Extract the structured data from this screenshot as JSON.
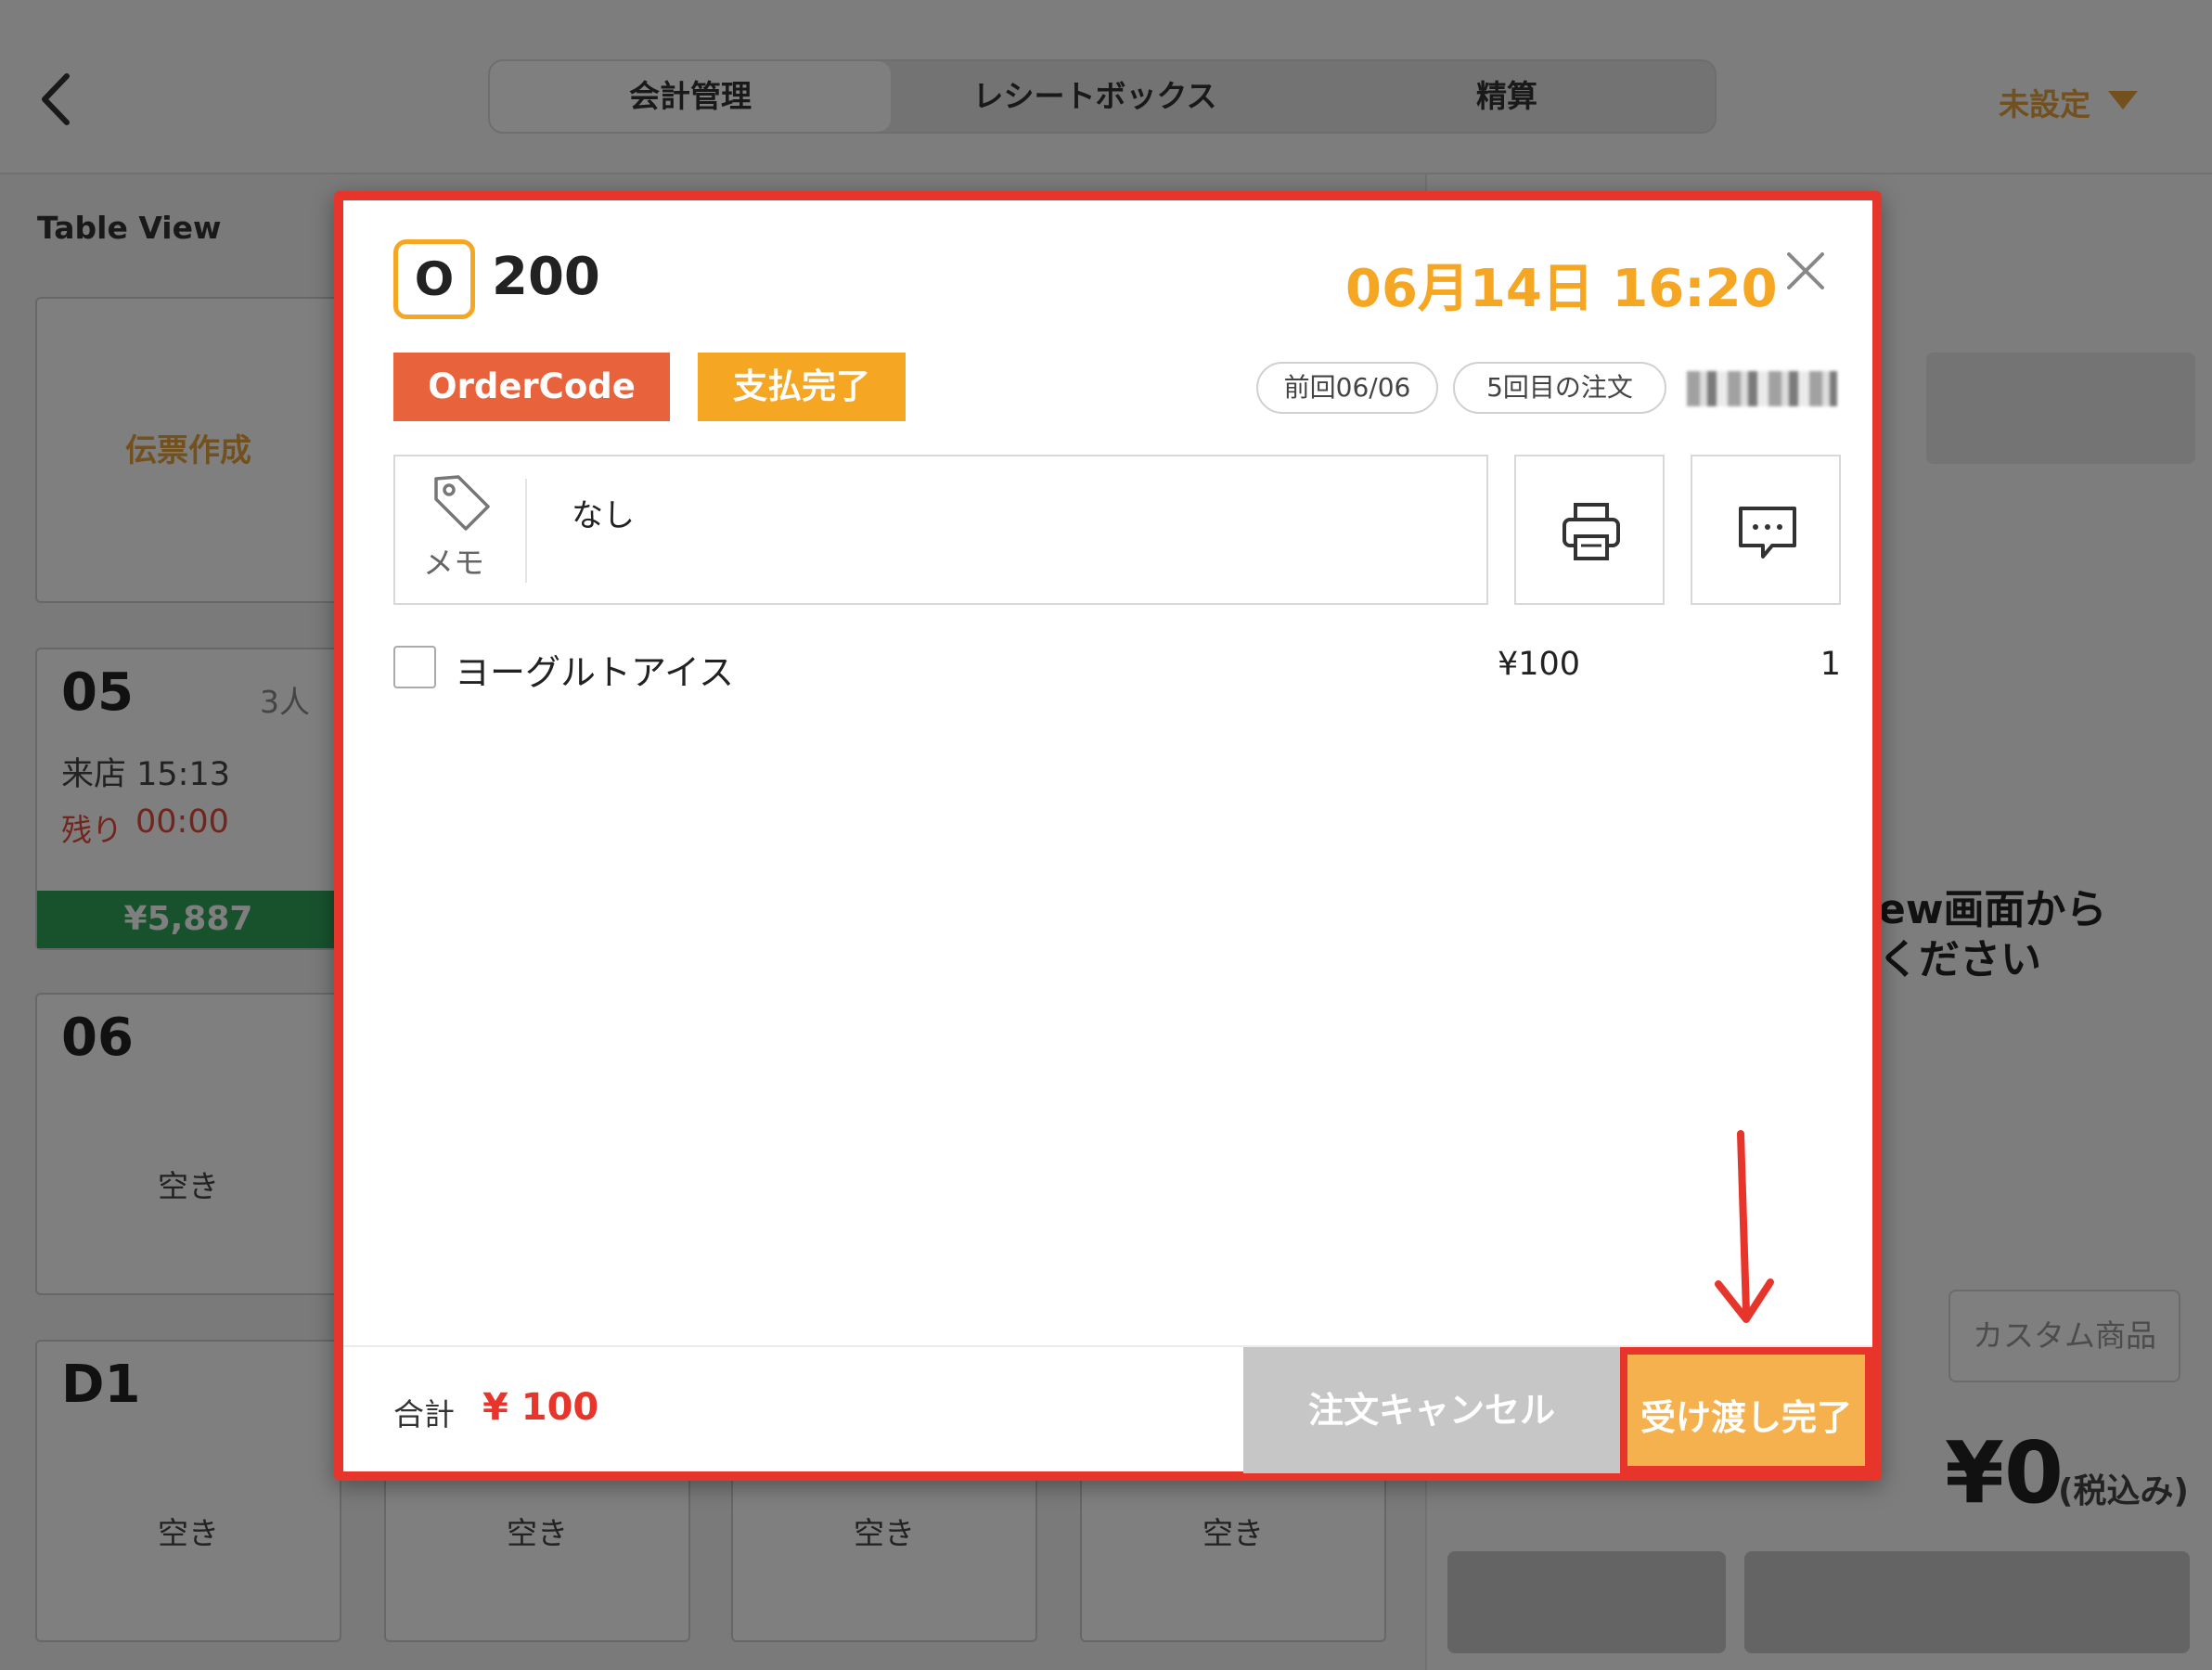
{
  "header": {
    "tabs": [
      "会計管理",
      "レシートボックス",
      "精算"
    ],
    "active_tab": "会計管理",
    "status_label": "未設定"
  },
  "table_view": {
    "title": "Table View",
    "create_slip": "伝票作成",
    "tables": [
      {
        "name": "05",
        "people": "3人",
        "visit": "来店 15:13",
        "remain_label": "残り",
        "remain_time": "00:00",
        "amount": "¥5,887"
      },
      {
        "name": "06",
        "status": "空き"
      },
      {
        "name": "D1",
        "status": "空き"
      }
    ],
    "empty_label": "空き"
  },
  "right_panel": {
    "message_line1": "ew画面から",
    "message_line2": "ください",
    "custom_item": "カスタム商品",
    "total": "¥0",
    "tax_label": "(税込み)"
  },
  "modal": {
    "order_type_badge": "O",
    "order_number": "200",
    "datetime": "06月14日 16:20",
    "tag_order_code": "OrderCode",
    "tag_paid": "支払完了",
    "pill_previous": "前回06/06",
    "pill_order_count": "5回目の注文",
    "memo_label": "メモ",
    "memo_text": "なし",
    "items": [
      {
        "name": "ヨーグルトアイス",
        "price": "¥100",
        "qty": "1"
      }
    ],
    "total_label": "合計",
    "total_value": "¥ 100",
    "cancel_button": "注文キャンセル",
    "done_button": "受け渡し完了"
  },
  "colors": {
    "accent_orange": "#f5a623",
    "order_code_red": "#e8623c",
    "highlight_red": "#e8352b",
    "amount_green": "#2fa55a"
  }
}
